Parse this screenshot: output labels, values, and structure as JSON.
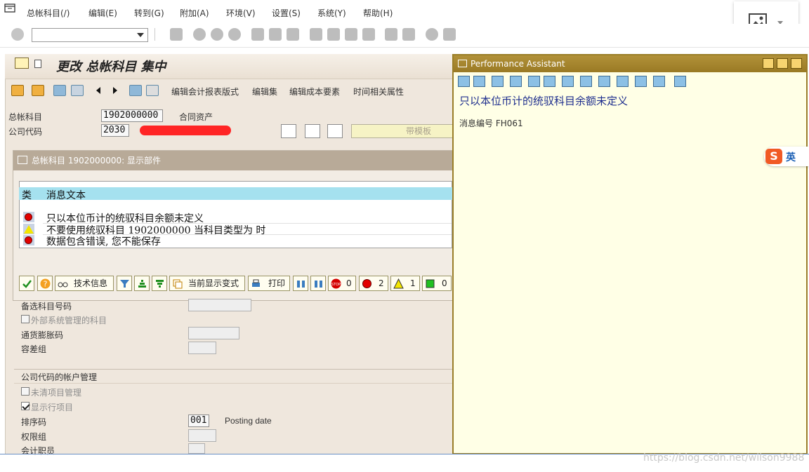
{
  "menubar": {
    "items": [
      "总帐科目(/)",
      "编辑(E)",
      "转到(G)",
      "附加(A)",
      "环境(V)",
      "设置(S)",
      "系统(Y)",
      "帮助(H)"
    ]
  },
  "toolbar": {
    "command_field": ""
  },
  "screen": {
    "title": "更改 总帐科目 集中",
    "app_toolbar": [
      "编辑会计报表版式",
      "编辑集",
      "编辑成本要素",
      "时间相关属性"
    ],
    "gl_account_label": "总帐科目",
    "gl_account_value": "1902000000",
    "gl_account_desc": "合同资产",
    "company_code_label": "公司代码",
    "company_code_value": "2030",
    "template_button": "带模板"
  },
  "message_dialog": {
    "title": "总帐科目 1902000000: 显示部件",
    "col_type": "类",
    "col_text": "消息文本",
    "rows": [
      {
        "type": "error",
        "text": "只以本位币计的统驭科目余额未定义"
      },
      {
        "type": "warning",
        "text": "不要使用统驭科目 1902000000 当科目类型为  时"
      },
      {
        "type": "error",
        "text": "数据包含错误, 您不能保存"
      }
    ],
    "buttons": {
      "tech_info": "技术信息",
      "current_layout": "当前显示变式",
      "print": "打印",
      "stop_count": "0",
      "error_count": "2",
      "warning_count": "1",
      "success_count": "0"
    }
  },
  "form": {
    "alt_account_label": "备选科目号码",
    "ext_system_label": "外部系统管理的科目",
    "inflation_key_label": "通货膨胀码",
    "tolerance_group_label": "容差组",
    "section_title": "公司代码的帐户管理",
    "open_item_label": "未清项目管理",
    "line_items_label": "显示行项目",
    "sort_key_label": "排序码",
    "sort_key_value": "001",
    "sort_key_desc": "Posting date",
    "auth_group_label": "权限组",
    "accounting_clerk_label": "会计职员"
  },
  "performance_assistant": {
    "title": "Performance Assistant",
    "heading": "只以本位币计的统驭科目余额未定义",
    "message_no": "消息编号 FH061"
  },
  "ime": {
    "logo": "S",
    "mode": "英"
  },
  "watermark": "https://blog.csdn.net/wilson9988"
}
